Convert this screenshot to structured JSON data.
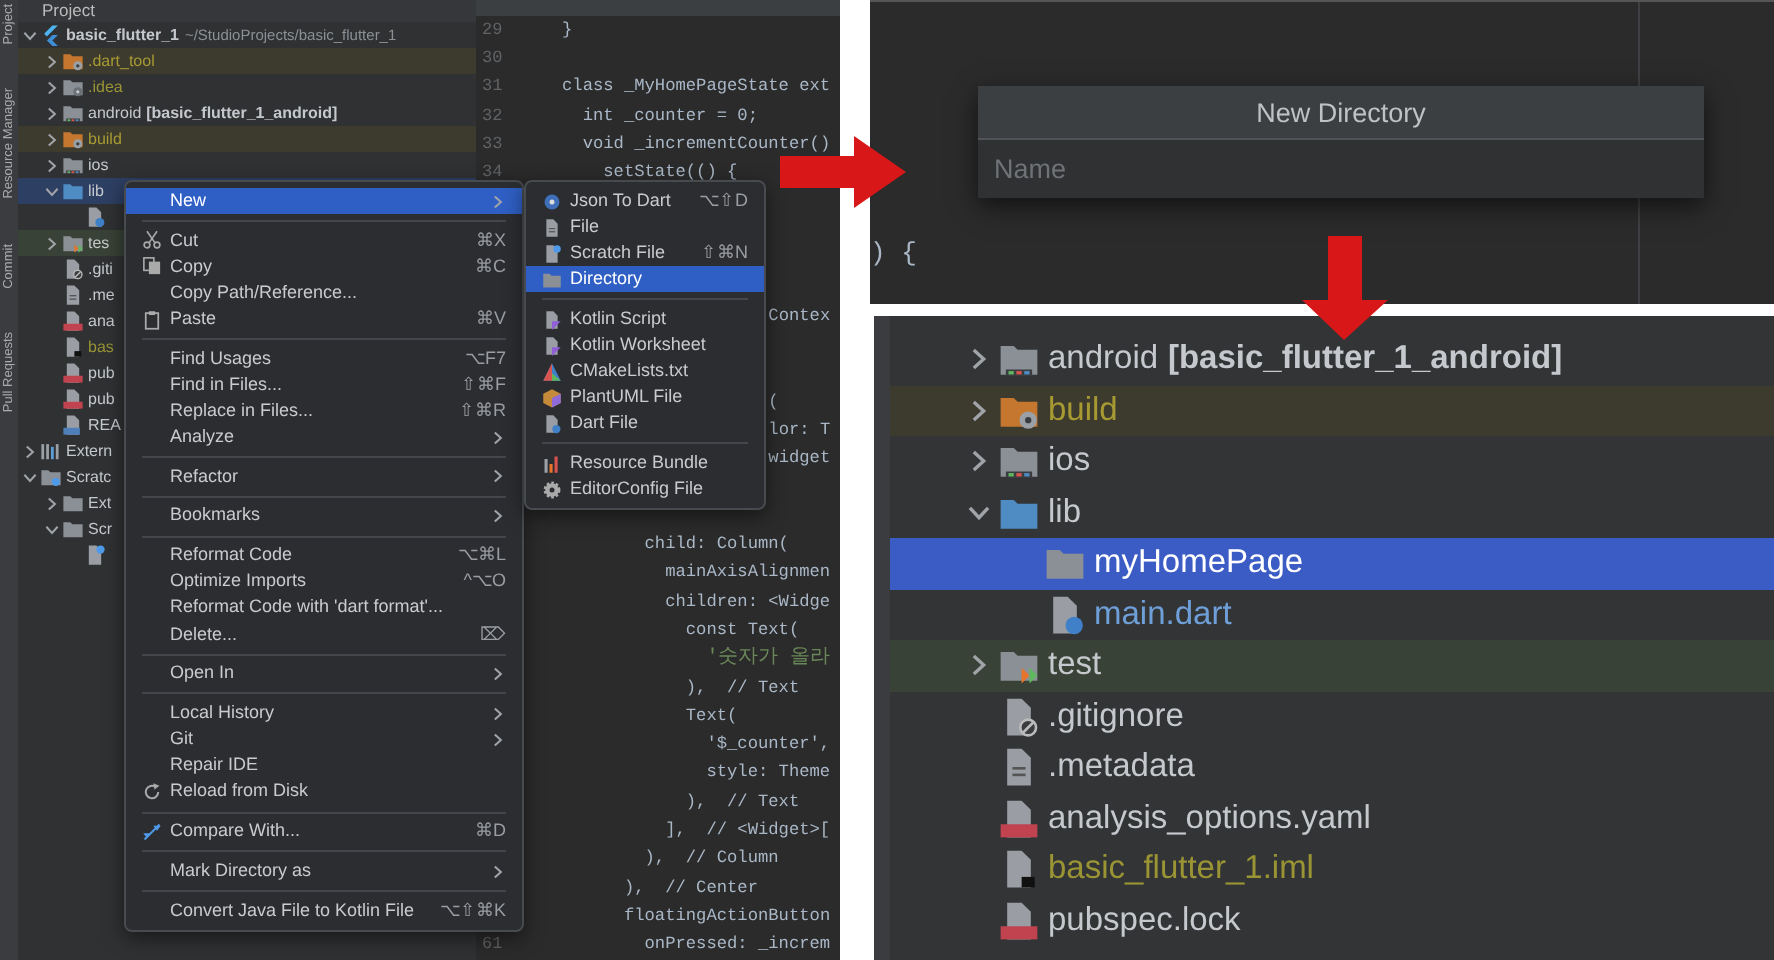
{
  "left_panel": {
    "tool_strip": [
      "Project",
      "Resource Manager",
      "Commit",
      "Pull Requests"
    ],
    "project_header": "Project",
    "tree": [
      {
        "kind": "flutter",
        "label": "basic_flutter_1",
        "path": "~/StudioProjects/basic_flutter_1",
        "expanded": true,
        "selected": false,
        "children": [
          {
            "kind": "excluded-folder",
            "label": ".dart_tool",
            "excluded": true,
            "expanded": false,
            "selected": false
          },
          {
            "kind": "config-folder",
            "label": ".idea",
            "ignored": true,
            "expanded": false,
            "selected": false
          },
          {
            "kind": "module-folder",
            "label": "android",
            "module": "[basic_flutter_1_android]",
            "expanded": false,
            "selected": false
          },
          {
            "kind": "excluded-folder",
            "label": "build",
            "excluded": true,
            "expanded": false,
            "selected": false
          },
          {
            "kind": "module-folder",
            "label": "ios",
            "expanded": false,
            "selected": false
          },
          {
            "kind": "source-folder",
            "label": "lib",
            "expanded": true,
            "selected": true,
            "children": [
              {
                "kind": "dart-file",
                "selected": false
              }
            ]
          },
          {
            "kind": "test-folder",
            "label": "tes",
            "test_sources": true,
            "expanded": false,
            "selected": false
          },
          {
            "kind": "ignore-file",
            "label": ".giti",
            "selected": false
          },
          {
            "kind": "file",
            "label": ".me",
            "selected": false
          },
          {
            "kind": "yaml-file",
            "label": "ana",
            "selected": false
          },
          {
            "kind": "iml-file",
            "label": "bas",
            "ignored": true,
            "selected": false
          },
          {
            "kind": "yaml-file",
            "label": "pub",
            "selected": false
          },
          {
            "kind": "yaml-file",
            "label": "pub",
            "selected": false
          },
          {
            "kind": "readme-file",
            "label": "REA",
            "selected": false
          }
        ]
      },
      {
        "kind": "libraries",
        "label": "Extern",
        "expanded": false,
        "selected": false
      },
      {
        "kind": "scratches",
        "label": "Scratc",
        "expanded": true,
        "selected": false,
        "children": [
          {
            "kind": "folder",
            "label": "Ext",
            "expanded": false,
            "selected": false
          },
          {
            "kind": "folder",
            "label": "Scr",
            "expanded": true,
            "selected": false,
            "children": [
              {
                "kind": "scratch-file",
                "selected": false
              }
            ]
          }
        ]
      }
    ],
    "editor": {
      "blocks": [
        [
          {
            "number": "29",
            "code": "}"
          },
          {
            "number": "30"
          },
          {
            "number": "31",
            "code": "class _MyHomePageState ext"
          },
          {
            "number": "32",
            "code": "  int _counter = 0;"
          },
          {
            "number": "33",
            "code": "  void _incrementCounter()"
          },
          {
            "number": "34",
            "code": "    setState(() {"
          }
        ],
        [
          {
            "code": "                    Contex"
          }
        ],
        [
          {
            "code": "                    ("
          },
          {
            "code": "                    lor: T"
          },
          {
            "code": "                    widget"
          }
        ],
        [
          {
            "code": "        child: Column("
          },
          {
            "code": "          mainAxisAlignmen"
          },
          {
            "code": "          children: <Widge"
          },
          {
            "code": "            const Text("
          },
          {
            "code": "              '숫자가 올라"
          },
          {
            "code": "            ),  // Text"
          },
          {
            "code": "            Text("
          },
          {
            "code": "              '$_counter',"
          },
          {
            "code": "              style: Theme"
          },
          {
            "code": "            ),  // Text"
          },
          {
            "code": "          ],  // <Widget>["
          },
          {
            "code": "        ),  // Column"
          },
          {
            "code": "      ),  // Center"
          },
          {
            "code": "      floatingActionButton"
          },
          {
            "number": "61",
            "code": "        onPressed: _increm"
          }
        ]
      ]
    }
  },
  "context_menu": [
    {
      "kind": "plain",
      "label": "New",
      "submenu": true,
      "selected": true
    },
    {
      "kind": "separator"
    },
    {
      "kind": "scissors",
      "label": "Cut",
      "shortcut": "⌘X",
      "selected": false
    },
    {
      "kind": "copy",
      "label": "Copy",
      "shortcut": "⌘C",
      "selected": false
    },
    {
      "kind": "plain",
      "label": "Copy Path/Reference...",
      "selected": false
    },
    {
      "kind": "clipboard",
      "label": "Paste",
      "shortcut": "⌘V",
      "selected": false
    },
    {
      "kind": "separator"
    },
    {
      "kind": "plain",
      "label": "Find Usages",
      "shortcut": "⌥F7",
      "selected": false
    },
    {
      "kind": "plain",
      "label": "Find in Files...",
      "shortcut": "⇧⌘F",
      "selected": false
    },
    {
      "kind": "plain",
      "label": "Replace in Files...",
      "shortcut": "⇧⌘R",
      "selected": false
    },
    {
      "kind": "plain",
      "label": "Analyze",
      "submenu": true,
      "selected": false
    },
    {
      "kind": "separator"
    },
    {
      "kind": "plain",
      "label": "Refactor",
      "submenu": true,
      "selected": false
    },
    {
      "kind": "separator"
    },
    {
      "kind": "plain",
      "label": "Bookmarks",
      "submenu": true,
      "selected": false
    },
    {
      "kind": "separator"
    },
    {
      "kind": "plain",
      "label": "Reformat Code",
      "shortcut": "⌥⌘L",
      "selected": false
    },
    {
      "kind": "plain",
      "label": "Optimize Imports",
      "shortcut": "^⌥O",
      "selected": false
    },
    {
      "kind": "plain",
      "label": "Reformat Code with 'dart format'...",
      "selected": false
    },
    {
      "kind": "plain",
      "label": "Delete...",
      "shortcut": "⌦",
      "selected": false
    },
    {
      "kind": "separator"
    },
    {
      "kind": "plain",
      "label": "Open In",
      "submenu": true,
      "selected": false
    },
    {
      "kind": "separator"
    },
    {
      "kind": "plain",
      "label": "Local History",
      "submenu": true,
      "selected": false
    },
    {
      "kind": "plain",
      "label": "Git",
      "submenu": true,
      "selected": false
    },
    {
      "kind": "plain",
      "label": "Repair IDE",
      "selected": false
    },
    {
      "kind": "refresh",
      "label": "Reload from Disk",
      "selected": false
    },
    {
      "kind": "separator"
    },
    {
      "kind": "compare",
      "label": "Compare With...",
      "shortcut": "⌘D",
      "selected": false
    },
    {
      "kind": "separator"
    },
    {
      "kind": "plain",
      "label": "Mark Directory as",
      "submenu": true,
      "selected": false
    },
    {
      "kind": "separator"
    },
    {
      "kind": "plain",
      "label": "Convert Java File to Kotlin File",
      "shortcut": "⌥⇧⌘K",
      "selected": false
    }
  ],
  "submenu": [
    {
      "kind": "json",
      "label": "Json To Dart",
      "shortcut": "⌥⇧D",
      "selected": false
    },
    {
      "kind": "file",
      "label": "File",
      "selected": false
    },
    {
      "kind": "scratch-file",
      "label": "Scratch File",
      "shortcut": "⇧⌘N",
      "selected": false
    },
    {
      "kind": "folder",
      "label": "Directory",
      "selected": true
    },
    {
      "kind": "separator"
    },
    {
      "kind": "kotlin-file",
      "label": "Kotlin Script",
      "selected": false
    },
    {
      "kind": "kotlin-file",
      "label": "Kotlin Worksheet",
      "selected": false
    },
    {
      "kind": "cmake",
      "label": "CMakeLists.txt",
      "selected": false
    },
    {
      "kind": "plantuml",
      "label": "PlantUML File",
      "selected": false
    },
    {
      "kind": "dart-file",
      "label": "Dart File",
      "selected": false
    },
    {
      "kind": "separator"
    },
    {
      "kind": "resource-bundle",
      "label": "Resource Bundle",
      "selected": false
    },
    {
      "kind": "gear",
      "label": "EditorConfig File",
      "selected": false
    }
  ],
  "editor_fragment": ") {",
  "new_directory_dialog": {
    "title": "New Directory",
    "placeholder": "Name"
  },
  "right_tree": [
    {
      "kind": "module-folder",
      "label": "android",
      "module": "[basic_flutter_1_android]",
      "expanded": false,
      "selected": false
    },
    {
      "kind": "excluded-folder",
      "label": "build",
      "excluded": true,
      "expanded": false,
      "selected": false
    },
    {
      "kind": "module-folder",
      "label": "ios",
      "expanded": false,
      "selected": false
    },
    {
      "kind": "source-folder",
      "label": "lib",
      "expanded": true,
      "selected": false,
      "children": [
        {
          "kind": "folder",
          "label": "myHomePage",
          "selected": true
        },
        {
          "kind": "dart-file",
          "label": "main.dart",
          "modified": true,
          "selected": false
        }
      ]
    },
    {
      "kind": "test-folder",
      "label": "test",
      "test_sources": true,
      "expanded": false,
      "selected": false
    },
    {
      "kind": "ignore-file",
      "label": ".gitignore",
      "selected": false
    },
    {
      "kind": "file",
      "label": ".metadata",
      "selected": false
    },
    {
      "kind": "yaml-file",
      "label": "analysis_options.yaml",
      "selected": false
    },
    {
      "kind": "iml-file",
      "label": "basic_flutter_1.iml",
      "ignored": true,
      "selected": false
    },
    {
      "kind": "yaml-file",
      "label": "pubspec.lock",
      "selected": false
    }
  ]
}
